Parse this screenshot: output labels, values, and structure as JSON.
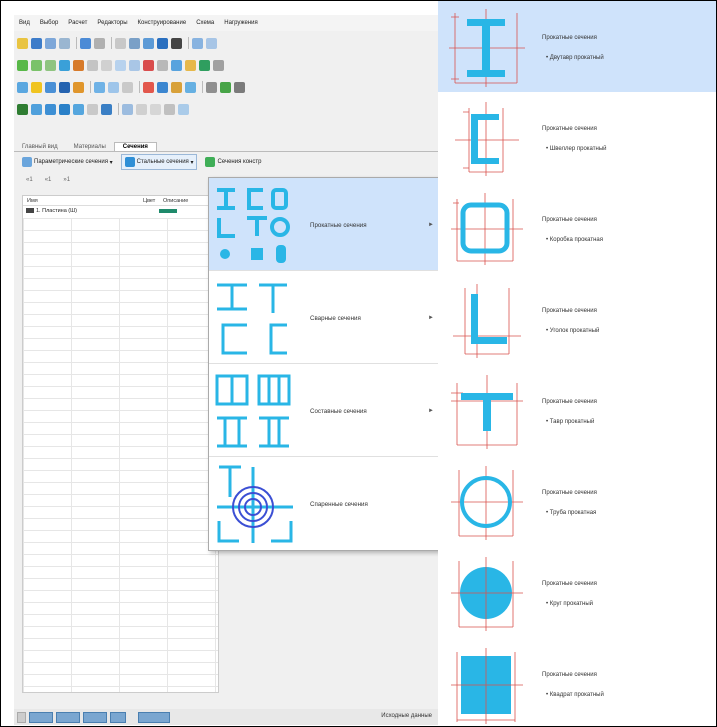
{
  "app": {
    "menu": [
      "Вид",
      "Выбор",
      "Расчет",
      "Редакторы",
      "Конструирование",
      "Схема",
      "Нагружения"
    ],
    "tabs": [
      "Главный вид",
      "Материалы",
      "Сечения"
    ],
    "active_tab": "Сечения",
    "ribbon": {
      "param_sections": "Параметрические сечения",
      "steel_sections": "Стальные сечения",
      "section_from": "Сечения констр"
    },
    "nav": [
      "«1",
      "«1",
      "»1"
    ],
    "panel": {
      "col_name": "Имя",
      "col_color": "Цвет",
      "col_desc": "Описание",
      "row1_name": "1. Пластина (Ш)"
    },
    "status_text": "Исходные данные"
  },
  "dropdown": {
    "items": [
      {
        "label": "Прокатные сечения",
        "has_submenu": true,
        "highlighted": true
      },
      {
        "label": "Сварные сечения",
        "has_submenu": true,
        "highlighted": false
      },
      {
        "label": "Составные сечения",
        "has_submenu": true,
        "highlighted": false
      },
      {
        "label": "Спаренные сечения",
        "has_submenu": false,
        "highlighted": false
      }
    ],
    "arrow": "►"
  },
  "flyout": {
    "group_label": "Прокатные сечения",
    "items": [
      {
        "name": "Двутавр прокатный",
        "icon": "i-beam-icon",
        "highlighted": true
      },
      {
        "name": "Швеллер прокатный",
        "icon": "channel-icon",
        "highlighted": false
      },
      {
        "name": "Коробка прокатная",
        "icon": "box-section-icon",
        "highlighted": false
      },
      {
        "name": "Уголок прокатный",
        "icon": "angle-icon",
        "highlighted": false
      },
      {
        "name": "Тавр прокатный",
        "icon": "tee-icon",
        "highlighted": false
      },
      {
        "name": "Труба прокатная",
        "icon": "pipe-icon",
        "highlighted": false
      },
      {
        "name": "Круг прокатный",
        "icon": "round-bar-icon",
        "highlighted": false
      },
      {
        "name": "Квадрат прокатный",
        "icon": "square-bar-icon",
        "highlighted": false
      }
    ]
  },
  "colors": {
    "highlight": "#cfe3fb",
    "section_cyan": "#29b6e6",
    "dimension_red": "#d9534f"
  }
}
